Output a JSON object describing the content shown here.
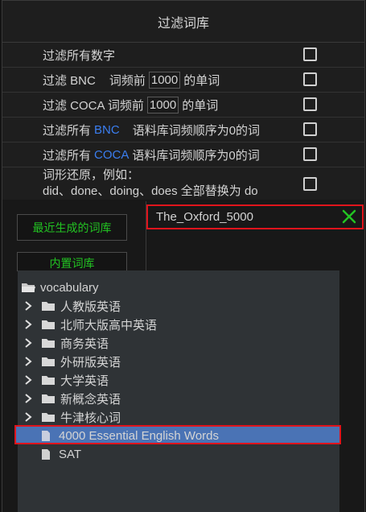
{
  "filter_panel": {
    "title": "过滤词库",
    "options": [
      {
        "label": "过滤所有数字"
      },
      {
        "pre": "过滤 BNC",
        "mid": "词频前",
        "value": "1000",
        "post": "的单词"
      },
      {
        "pre": "过滤 COCA 词频前",
        "value": "1000",
        "post": "的单词"
      },
      {
        "pre": "过滤所有",
        "corpus": "BNC",
        "post": "语料库词频顺序为0的词"
      },
      {
        "pre": "过滤所有",
        "corpus": "COCA",
        "post": "语料库词频顺序为0的词"
      },
      {
        "line1": "词形还原，例如：",
        "line2": "did、done、doing、does 全部替换为 do"
      }
    ]
  },
  "sidebar": {
    "recent_button": "最近生成的词库",
    "builtin_button": "内置词库"
  },
  "selected_library": {
    "name": "The_Oxford_5000",
    "close_icon": "close-x-icon",
    "close_color": "#22c322"
  },
  "tree": {
    "root": "vocabulary",
    "folders": [
      "人教版英语",
      "北师大版高中英语",
      "商务英语",
      "外研版英语",
      "大学英语",
      "新概念英语",
      "牛津核心词"
    ],
    "files": [
      "4000 Essential English Words",
      "SAT"
    ],
    "selected_file": "4000 Essential English Words"
  },
  "colors": {
    "accent_green": "#22c322",
    "accent_blue": "#3b7ef0",
    "highlight_red": "#e0141c",
    "selection_blue": "#4a73b5"
  }
}
